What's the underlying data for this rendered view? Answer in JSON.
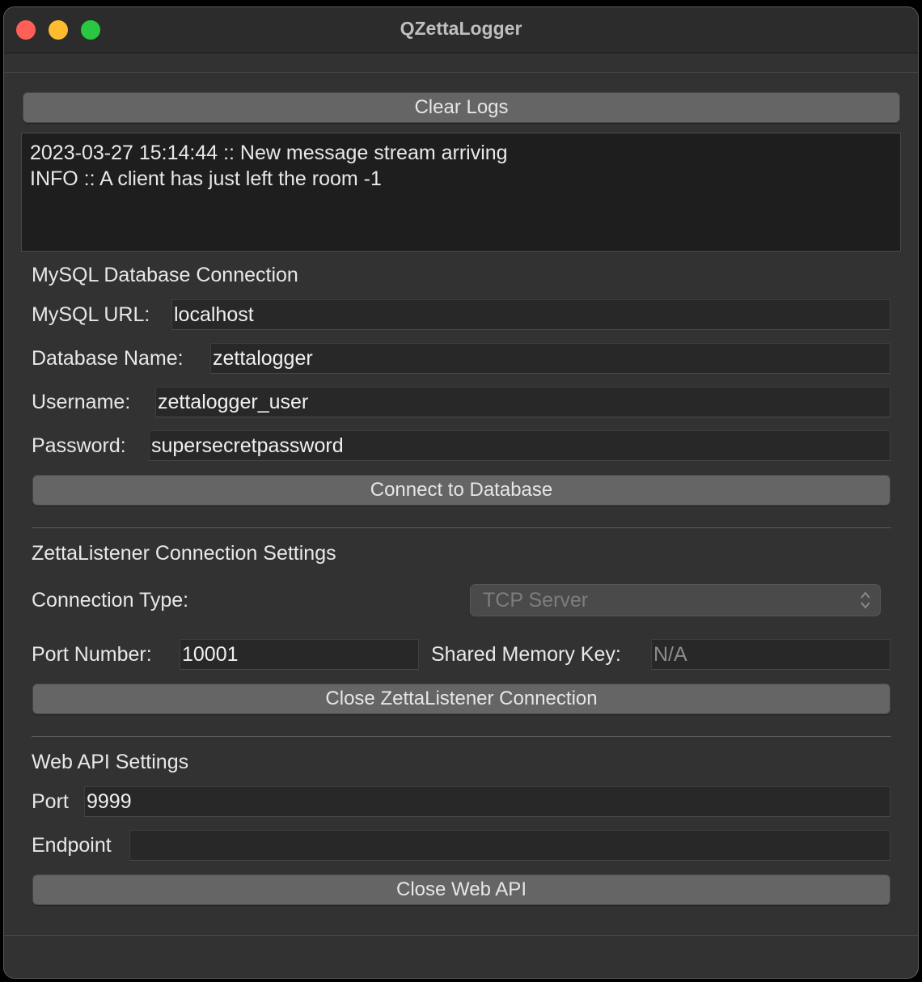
{
  "window": {
    "title": "QZettaLogger"
  },
  "logs": {
    "clear_label": "Clear Logs",
    "lines": [
      "2023-03-27 15:14:44 :: New message stream arriving",
      "INFO :: A client has just left the room -1"
    ]
  },
  "mysql": {
    "section_title": "MySQL Database Connection",
    "url_label": "MySQL URL:",
    "url_value": "localhost",
    "dbname_label": "Database Name:",
    "dbname_value": "zettalogger",
    "username_label": "Username:",
    "username_value": "zettalogger_user",
    "password_label": "Password:",
    "password_value": "supersecretpassword",
    "connect_label": "Connect to Database"
  },
  "listener": {
    "section_title": "ZettaListener Connection Settings",
    "conn_type_label": "Connection Type:",
    "conn_type_value": "TCP Server",
    "port_label": "Port Number:",
    "port_value": "10001",
    "shm_label": "Shared Memory Key:",
    "shm_placeholder": "N/A",
    "close_label": "Close ZettaListener Connection"
  },
  "webapi": {
    "section_title": "Web API Settings",
    "port_label": "Port",
    "port_value": "9999",
    "endpoint_label": "Endpoint",
    "endpoint_value": "",
    "close_label": "Close Web API"
  },
  "colors": {
    "close": "#ff5f57",
    "minimize": "#febc2e",
    "maximize": "#28c840"
  }
}
